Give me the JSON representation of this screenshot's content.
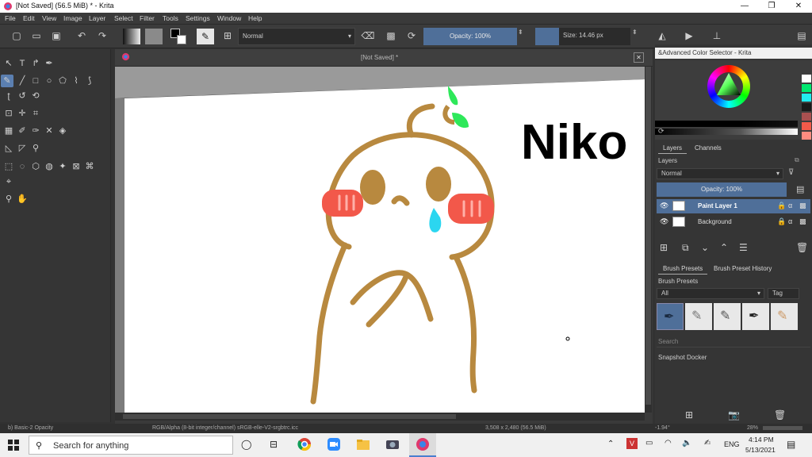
{
  "window": {
    "title": "[Not Saved]  (56.5 MiB)  * - Krita",
    "minimize_glyph": "—",
    "maximize_glyph": "❐",
    "close_glyph": "✕"
  },
  "menu": [
    "File",
    "Edit",
    "View",
    "Image",
    "Layer",
    "Select",
    "Filter",
    "Tools",
    "Settings",
    "Window",
    "Help"
  ],
  "toolbar": {
    "blend_mode": "Normal",
    "opacity_label": "Opacity: 100%",
    "size_label": "Size: 14.46 px"
  },
  "document": {
    "tab_title": "[Not Saved]  *",
    "close_glyph": "✕",
    "drawing_text": "Niko"
  },
  "color_selector": {
    "title": "&Advanced Color Selector - Krita"
  },
  "layers_docker": {
    "tabs": [
      "Layers",
      "Channels"
    ],
    "header": "Layers",
    "blend_mode": "Normal",
    "opacity_label": "Opacity:  100%",
    "layers": [
      {
        "name": "Paint Layer 1",
        "selected": true
      },
      {
        "name": "Background",
        "selected": false
      }
    ]
  },
  "brush_docker": {
    "tabs": [
      "Brush Presets",
      "Brush Preset History"
    ],
    "header": "Brush Presets",
    "filter": "All",
    "tag_label": "Tag",
    "search_placeholder": "Search"
  },
  "snapshot_docker": {
    "header": "Snapshot Docker"
  },
  "statusbar": {
    "brush": "b) Basic-2 Opacity",
    "colorspace": "RGB/Alpha (8-bit integer/channel)  sRGB-elle-V2-srgbtrc.icc",
    "dimensions": "3,508 x 2,480 (56.5 MiB)",
    "rotation": "-1.94°",
    "zoom": "28%"
  },
  "taskbar": {
    "search_placeholder": "Search for anything",
    "language": "ENG",
    "time": "4:14 PM",
    "date": "5/13/2021"
  },
  "colors": {
    "accent": "#5b7fb0",
    "drawing_brown": "#b8893f",
    "cheek_red": "#f2584a",
    "leaf_green": "#2ee85a",
    "tear_cyan": "#2bd6f0"
  }
}
